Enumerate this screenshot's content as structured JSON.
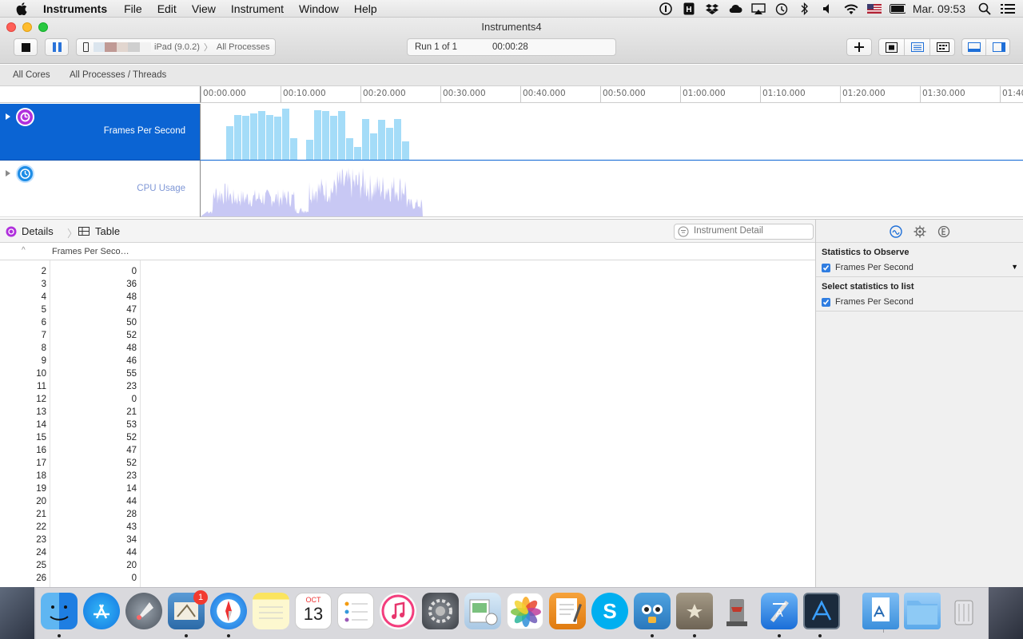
{
  "menubar": {
    "app_name": "Instruments",
    "items": [
      "File",
      "Edit",
      "View",
      "Instrument",
      "Window",
      "Help"
    ],
    "clock": "Mar. 09:53",
    "status_icons": [
      "onepassword-icon",
      "h-icon",
      "dropbox-icon",
      "cloud-icon",
      "airplay-icon",
      "time-machine-icon",
      "bluetooth-icon",
      "volume-icon",
      "wifi-icon",
      "flag-icon",
      "battery-icon",
      "spotlight-icon",
      "list-icon"
    ]
  },
  "window": {
    "title": "Instruments4",
    "target_label": "iPad (9.0.2)",
    "process_label": "All Processes",
    "run_label": "Run 1 of 1",
    "run_time": "00:00:28"
  },
  "scopebar": {
    "cores": "All Cores",
    "threads": "All Processes / Threads"
  },
  "timeline": {
    "ticks": [
      "00:00.000",
      "00:10.000",
      "00:20.000",
      "00:30.000",
      "00:40.000",
      "00:50.000",
      "01:00.000",
      "01:10.000",
      "01:20.000",
      "01:30.000",
      "01:40"
    ],
    "tracks": [
      {
        "name": "Frames Per Second"
      },
      {
        "name": "CPU Usage"
      }
    ]
  },
  "detail": {
    "crumb1": "Details",
    "crumb2": "Table",
    "search_placeholder": "Instrument Detail"
  },
  "table": {
    "column_header": "Frames Per Seco…",
    "rows": [
      [
        "2",
        "0"
      ],
      [
        "3",
        "36"
      ],
      [
        "4",
        "48"
      ],
      [
        "5",
        "47"
      ],
      [
        "6",
        "50"
      ],
      [
        "7",
        "52"
      ],
      [
        "8",
        "48"
      ],
      [
        "9",
        "46"
      ],
      [
        "10",
        "55"
      ],
      [
        "11",
        "23"
      ],
      [
        "12",
        "0"
      ],
      [
        "13",
        "21"
      ],
      [
        "14",
        "53"
      ],
      [
        "15",
        "52"
      ],
      [
        "16",
        "47"
      ],
      [
        "17",
        "52"
      ],
      [
        "18",
        "23"
      ],
      [
        "19",
        "14"
      ],
      [
        "20",
        "44"
      ],
      [
        "21",
        "28"
      ],
      [
        "22",
        "43"
      ],
      [
        "23",
        "34"
      ],
      [
        "24",
        "44"
      ],
      [
        "25",
        "20"
      ],
      [
        "26",
        "0"
      ]
    ]
  },
  "inspector": {
    "section1_title": "Statistics to Observe",
    "section1_item": "Frames Per Second",
    "section2_title": "Select statistics to list",
    "section2_item": "Frames Per Second"
  },
  "dock": {
    "apps": [
      "finder",
      "app-store",
      "launchpad",
      "mail",
      "safari",
      "notes",
      "calendar",
      "reminders",
      "itunes",
      "system-preferences",
      "preview",
      "photos",
      "pages",
      "skype",
      "tweetbot",
      "archive",
      "git-tower",
      "xcode",
      "instruments",
      "documents-folder",
      "downloads-folder",
      "trash"
    ],
    "mail_badge": "1",
    "calendar_month": "OCT",
    "calendar_day": "13"
  },
  "colors": {
    "accent": "#0b64d3",
    "fps_bar": "#a4dcf8",
    "cpu_fill": "#c8c8f4"
  }
}
